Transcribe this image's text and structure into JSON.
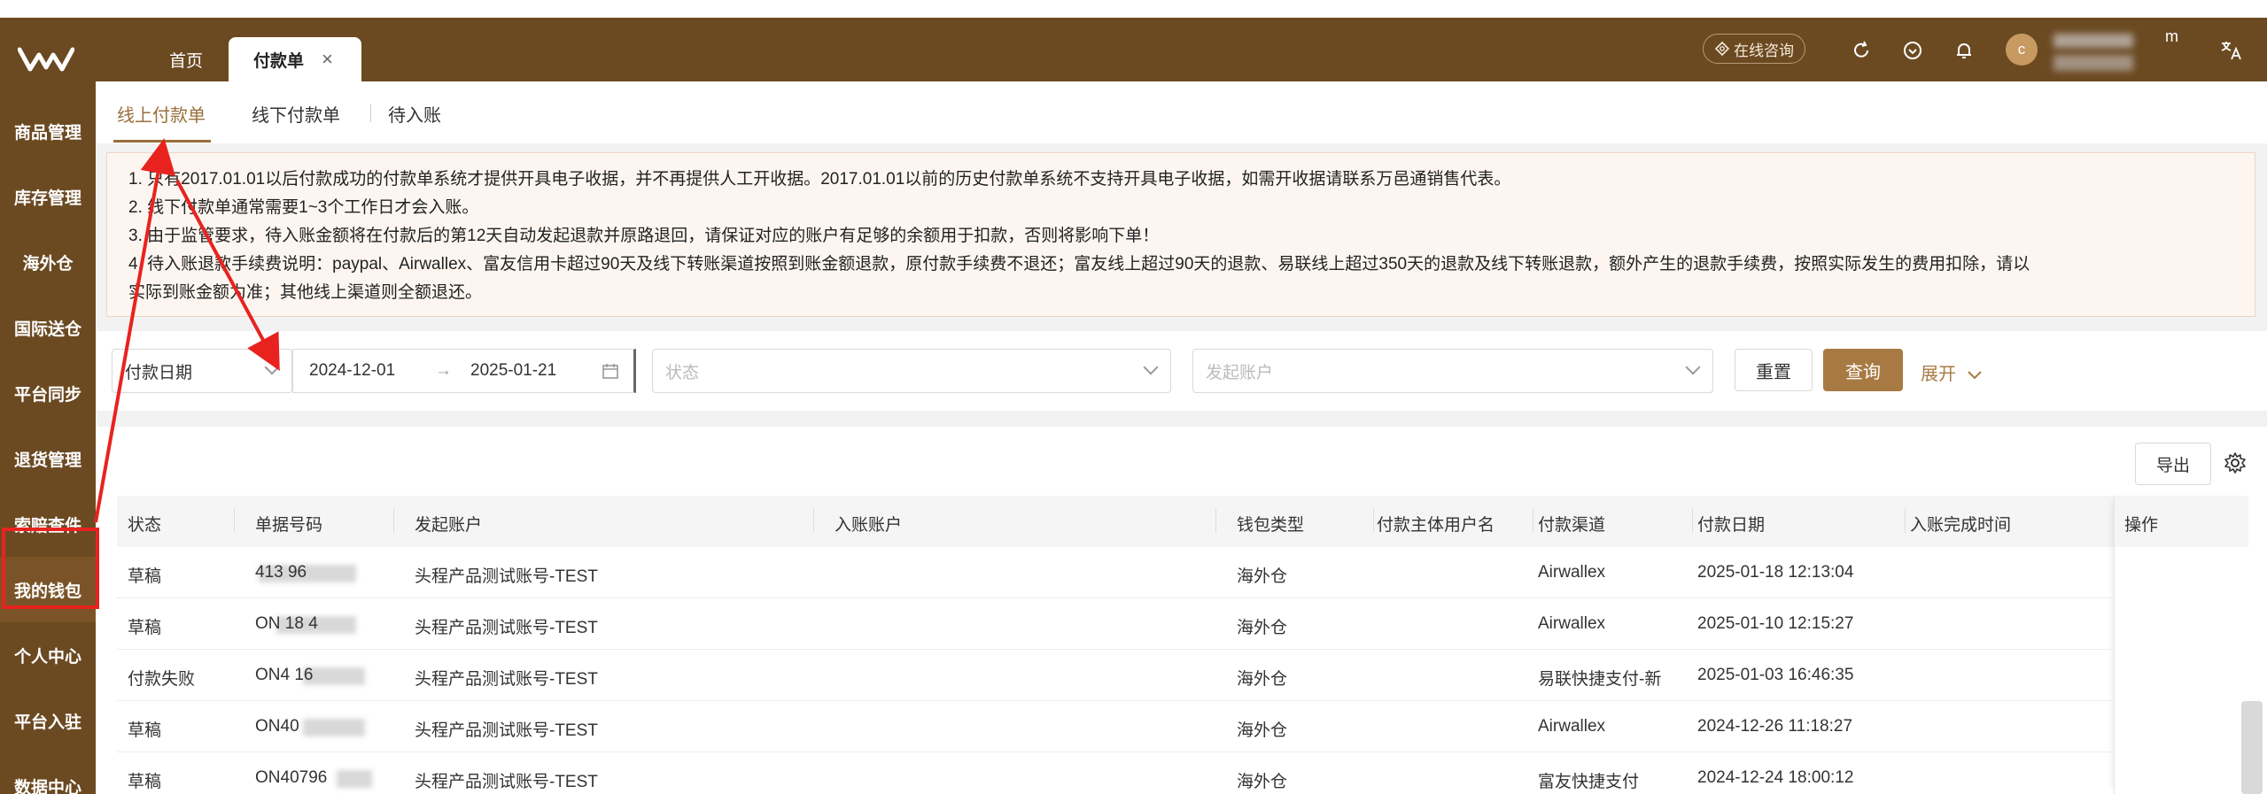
{
  "sidebar": {
    "items": [
      {
        "label": "商品管理"
      },
      {
        "label": "库存管理"
      },
      {
        "label": "海外仓"
      },
      {
        "label": "国际送仓"
      },
      {
        "label": "平台同步"
      },
      {
        "label": "退货管理"
      },
      {
        "label": "索赔查件"
      },
      {
        "label": "我的钱包"
      },
      {
        "label": "个人中心"
      },
      {
        "label": "平台入驻"
      },
      {
        "label": "数据中心"
      }
    ]
  },
  "header": {
    "tabs": [
      {
        "label": "首页"
      },
      {
        "label": "付款单",
        "close": "×"
      }
    ],
    "consult_label": "在线咨询",
    "avatar_letter": "c",
    "user_suffix": "m"
  },
  "subtabs": [
    {
      "label": "线上付款单"
    },
    {
      "label": "线下付款单"
    },
    {
      "label": "待入账"
    }
  ],
  "notice": [
    "1. 只有2017.01.01以后付款成功的付款单系统才提供开具电子收据，并不再提供人工开收据。2017.01.01以前的历史付款单系统不支持开具电子收据，如需开收据请联系万邑通销售代表。",
    "2. 线下付款单通常需要1~3个工作日才会入账。",
    "3. 由于监管要求，待入账金额将在付款后的第12天自动发起退款并原路退回，请保证对应的账户有足够的余额用于扣款，否则将影响下单！",
    "4. 待入账退款手续费说明：paypal、Airwallex、富友信用卡超过90天及线下转账渠道按照到账金额退款，原付款手续费不退还；富友线上超过90天的退款、易联线上超过350天的退款及线下转账退款，额外产生的退款手续费，按照实际发生的费用扣除，请以",
    "实际到账金额为准；其他线上渠道则全额退还。"
  ],
  "filters": {
    "date_type": "付款日期",
    "date_from": "2024-12-01",
    "date_to": "2025-01-21",
    "arrow": "→",
    "status_placeholder": "状态",
    "account_placeholder": "发起账户",
    "reset_label": "重置",
    "query_label": "查询",
    "expand_label": "展开"
  },
  "table": {
    "export_label": "导出",
    "columns": [
      "状态",
      "单据号码",
      "发起账户",
      "入账账户",
      "钱包类型",
      "付款主体用户名",
      "付款渠道",
      "付款日期",
      "入账完成时间",
      "操作"
    ],
    "rows": [
      {
        "status": "草稿",
        "id_visible": "413  96",
        "account": "头程产品测试账号-TEST",
        "wallet": "海外仓",
        "channel": "Airwallex",
        "date": "2025-01-18 12:13:04"
      },
      {
        "status": "草稿",
        "id_visible": "ON   18  4",
        "account": "头程产品测试账号-TEST",
        "wallet": "海外仓",
        "channel": "Airwallex",
        "date": "2025-01-10 12:15:27"
      },
      {
        "status": "付款失败",
        "id_visible": "ON4   16",
        "account": "头程产品测试账号-TEST",
        "wallet": "海外仓",
        "channel": "易联快捷支付-新",
        "date": "2025-01-03 16:46:35"
      },
      {
        "status": "草稿",
        "id_visible": "ON40",
        "account": "头程产品测试账号-TEST",
        "wallet": "海外仓",
        "channel": "Airwallex",
        "date": "2024-12-26 11:18:27"
      },
      {
        "status": "草稿",
        "id_visible": "ON40796",
        "account": "头程产品测试账号-TEST",
        "wallet": "海外仓",
        "channel": "富友快捷支付",
        "date": "2024-12-24 18:00:12"
      }
    ]
  },
  "colors": {
    "brand_brown": "#6b4a22",
    "accent": "#a87a43",
    "annotation_red": "#e8231f"
  }
}
